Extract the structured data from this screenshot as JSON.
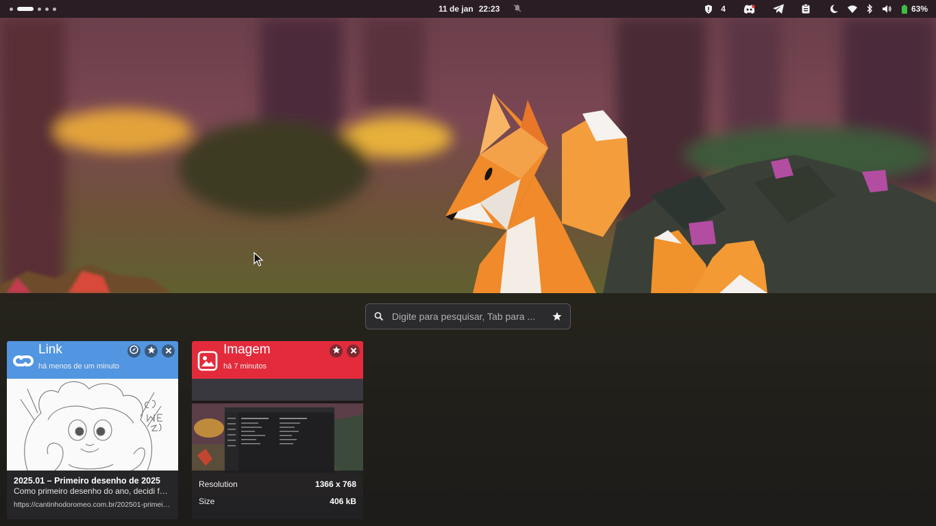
{
  "topbar": {
    "date": "11 de jan",
    "time": "22:23",
    "shield_count": "4",
    "battery": "63%",
    "icons": [
      "shield-icon",
      "discord-icon",
      "telegram-icon",
      "clipboard-icon",
      "night-light-icon",
      "wifi-icon",
      "bluetooth-icon",
      "volume-icon",
      "battery-icon"
    ]
  },
  "search": {
    "placeholder": "Digite para pesquisar, Tab para ..."
  },
  "cards": {
    "link": {
      "title": "Link",
      "time": "há menos de um minuto",
      "preview_title": "2025.01 – Primeiro desenho de 2025",
      "preview_desc": "Como primeiro desenho do ano, decidi fazer",
      "preview_url": "https://cantinhodoromeo.com.br/202501-primeiro-desenho"
    },
    "image": {
      "title": "Imagem",
      "time": "há 7 minutos",
      "resolution_label": "Resolution",
      "resolution_value": "1366 x 768",
      "size_label": "Size",
      "size_value": "406 kB"
    }
  },
  "colors": {
    "link_accent": "#5295e0",
    "image_accent": "#e32b3c",
    "topbar_bg": "#2a1d24"
  }
}
